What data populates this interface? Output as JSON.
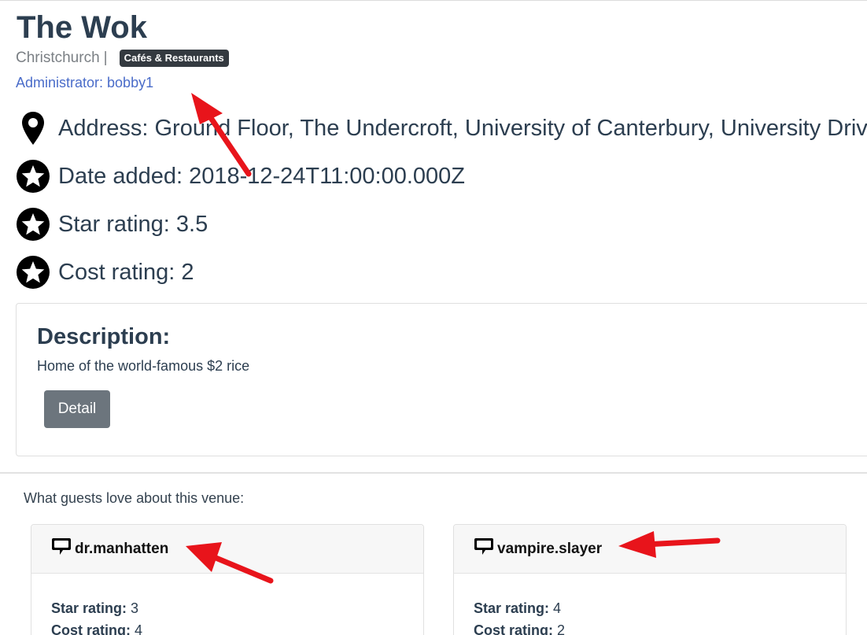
{
  "venue": {
    "name": "The Wok",
    "city": "Christchurch",
    "separator": "|",
    "category": "Cafés & Restaurants",
    "administrator": "Administrator: bobby1"
  },
  "info": {
    "address": "Address: Ground Floor, The Undercroft, University of Canterbury, University Drive",
    "date_added": "Date added: 2018-12-24T11:00:00.000Z",
    "star_rating": "Star rating: 3.5",
    "cost_rating": "Cost rating: 2"
  },
  "description": {
    "heading": "Description:",
    "text": "Home of the world-famous $2 rice",
    "detail_button": "Detail"
  },
  "reviews_section": {
    "heading": "What guests love about this venue:",
    "star_label": "Star rating:",
    "cost_label": "Cost rating:",
    "reviews": [
      {
        "user": "dr.manhatten",
        "star": "3",
        "cost": "4"
      },
      {
        "user": "vampire.slayer",
        "star": "4",
        "cost": "2"
      }
    ]
  },
  "icons": [
    "location-pin-icon",
    "star-circle-icon",
    "speech-bubble-icon"
  ],
  "colors": {
    "title": "#2c3e50",
    "link": "#4a6cc9",
    "badge_bg": "#343a40",
    "button_bg": "#6c757d",
    "annotation_arrow": "#e8141b"
  }
}
